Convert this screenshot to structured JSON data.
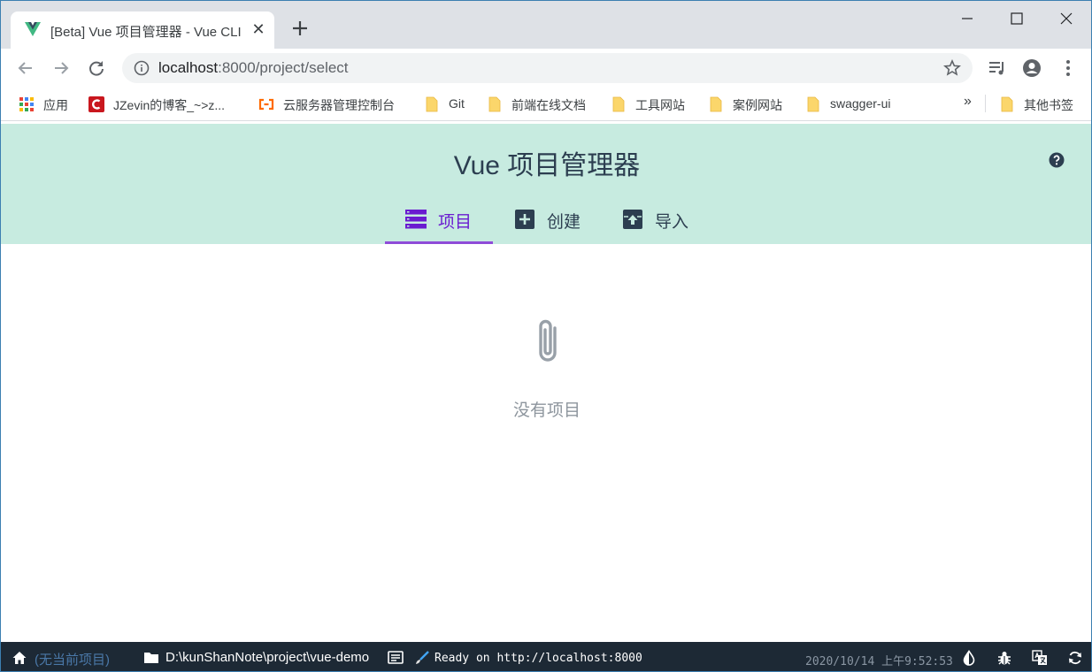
{
  "browser": {
    "tab_title": "[Beta] Vue 项目管理器 - Vue CLI",
    "url_host": "localhost",
    "url_rest": ":8000/project/select"
  },
  "bookmarks": [
    {
      "label": "应用",
      "icon": "apps-grid-icon"
    },
    {
      "label": "JZevin的博客_~>z...",
      "icon": "csdn-icon"
    },
    {
      "label": "云服务器管理控制台",
      "icon": "aliyun-icon"
    },
    {
      "label": "Git",
      "icon": "folder-icon"
    },
    {
      "label": "前端在线文档",
      "icon": "folder-icon"
    },
    {
      "label": "工具网站",
      "icon": "folder-icon"
    },
    {
      "label": "案例网站",
      "icon": "folder-icon"
    },
    {
      "label": "swagger-ui",
      "icon": "folder-icon"
    }
  ],
  "bookmarks_more": "»",
  "other_bookmarks": "其他书签",
  "app": {
    "title": "Vue 项目管理器",
    "tabs": [
      {
        "label": "项目",
        "icon": "list-icon",
        "active": true
      },
      {
        "label": "创建",
        "icon": "plus-box-icon",
        "active": false
      },
      {
        "label": "导入",
        "icon": "import-icon",
        "active": false
      }
    ],
    "empty_text": "没有项目"
  },
  "status_bar": {
    "current_project": "(无当前项目)",
    "path": "D:\\kunShanNote\\project\\vue-demo",
    "log": "Ready on http://localhost:8000",
    "datetime": "2020/10/14 上午9:52:53"
  },
  "colors": {
    "header_bg": "#c7ebe0",
    "accent": "#6a1bd0",
    "statusbar_bg": "#1d2935"
  }
}
